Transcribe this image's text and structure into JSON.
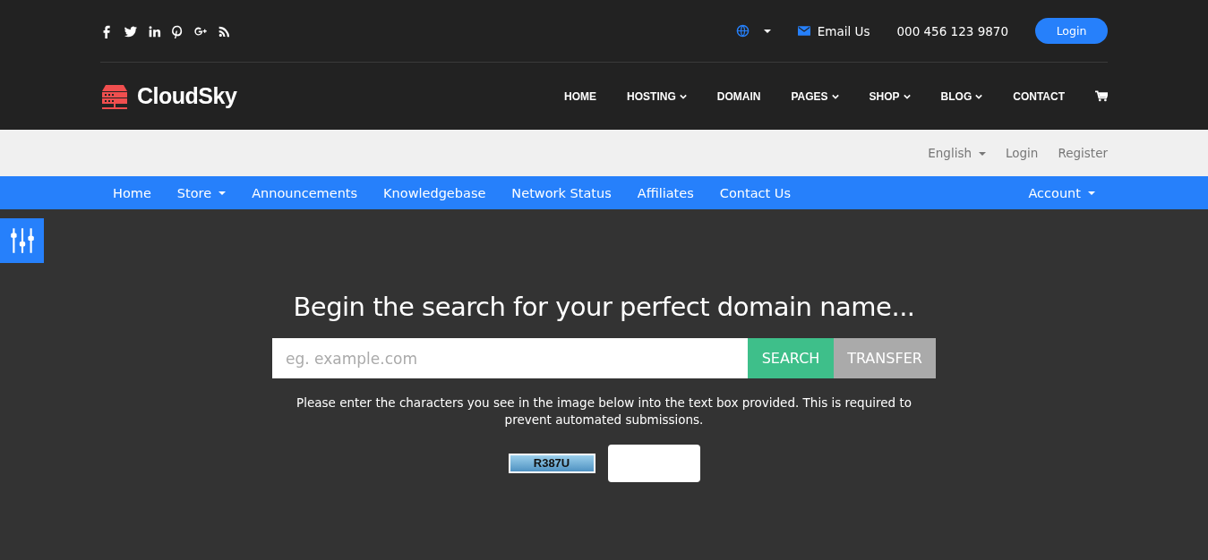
{
  "topbar": {
    "social": [
      {
        "kind": "facebook"
      },
      {
        "kind": "twitter"
      },
      {
        "kind": "linkedin"
      },
      {
        "kind": "pinterest"
      },
      {
        "kind": "google-plus"
      },
      {
        "kind": "rss"
      }
    ],
    "email": "Email Us",
    "phone": "000 456 123 9870",
    "login": "Login"
  },
  "header": {
    "logo": "CloudSky",
    "menu": [
      {
        "label": "HOME",
        "dropdown": false
      },
      {
        "label": "HOSTING",
        "dropdown": true
      },
      {
        "label": "DOMAIN",
        "dropdown": false
      },
      {
        "label": "PAGES",
        "dropdown": true
      },
      {
        "label": "SHOP",
        "dropdown": true
      },
      {
        "label": "BLOG",
        "dropdown": true
      },
      {
        "label": "CONTACT",
        "dropdown": false
      }
    ]
  },
  "account_bar": {
    "language": "English",
    "links": [
      "Login",
      "Register"
    ]
  },
  "client_nav": {
    "items": [
      {
        "label": "Home",
        "dropdown": false
      },
      {
        "label": "Store",
        "dropdown": true
      },
      {
        "label": "Announcements",
        "dropdown": false
      },
      {
        "label": "Knowledgebase",
        "dropdown": false
      },
      {
        "label": "Network Status",
        "dropdown": false
      },
      {
        "label": "Affiliates",
        "dropdown": false
      },
      {
        "label": "Contact Us",
        "dropdown": false
      }
    ],
    "account": "Account"
  },
  "hero": {
    "title": "Begin the search for your perfect domain name...",
    "placeholder": "eg. example.com",
    "search": "SEARCH",
    "transfer": "TRANSFER",
    "captcha_note": "Please enter the characters you see in the image below into the text box provided. This is required to prevent automated submissions.",
    "captcha_code": "R387U"
  }
}
